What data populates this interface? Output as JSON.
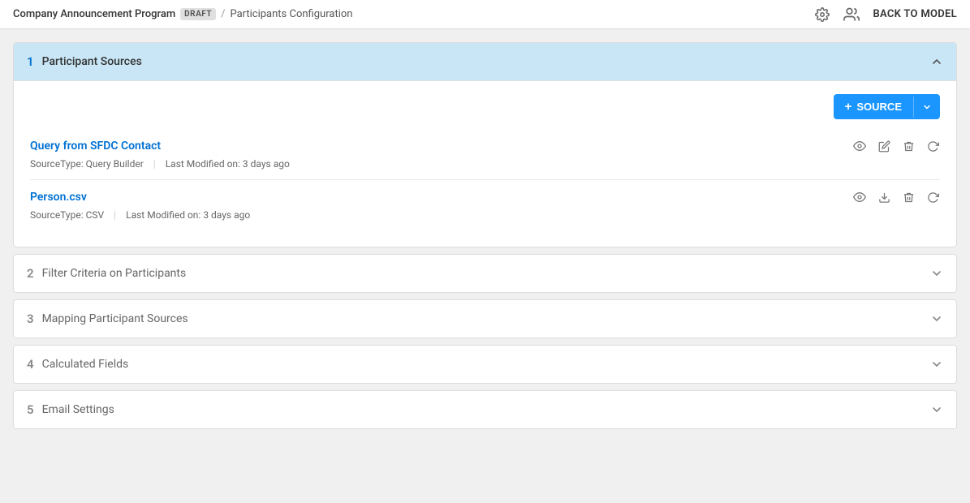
{
  "header": {
    "app_name": "Company Announcement Program",
    "draft_badge": "DRAFT",
    "separator": "/",
    "page_name": "Participants Configuration",
    "back_label": "BACK TO MODEL"
  },
  "sections": [
    {
      "id": 1,
      "number": "1",
      "title": "Participant Sources",
      "expanded": true,
      "source_button": "+ SOURCE",
      "sources": [
        {
          "name": "Query from SFDC Contact",
          "source_type_label": "SourceType: Query Builder",
          "last_modified_label": "Last Modified on: 3 days ago",
          "actions": [
            "preview",
            "edit",
            "delete",
            "refresh"
          ]
        },
        {
          "name": "Person.csv",
          "source_type_label": "SourceType: CSV",
          "last_modified_label": "Last Modified on: 3 days ago",
          "actions": [
            "preview",
            "download",
            "delete",
            "refresh"
          ]
        }
      ]
    },
    {
      "id": 2,
      "number": "2",
      "title": "Filter Criteria on Participants",
      "expanded": false
    },
    {
      "id": 3,
      "number": "3",
      "title": "Mapping Participant Sources",
      "expanded": false
    },
    {
      "id": 4,
      "number": "4",
      "title": "Calculated Fields",
      "expanded": false
    },
    {
      "id": 5,
      "number": "5",
      "title": "Email Settings",
      "expanded": false
    }
  ],
  "icons": {
    "gear": "⚙",
    "users": "👥",
    "chevron_up": "∧",
    "chevron_down": "∨",
    "plus": "+",
    "preview": "👁",
    "edit": "✎",
    "delete": "🗑",
    "refresh": "↻",
    "download": "⬇"
  },
  "colors": {
    "accent": "#1b96ff",
    "section_expanded_bg": "#c8e6f5",
    "section_number_expanded": "#0070d2"
  }
}
